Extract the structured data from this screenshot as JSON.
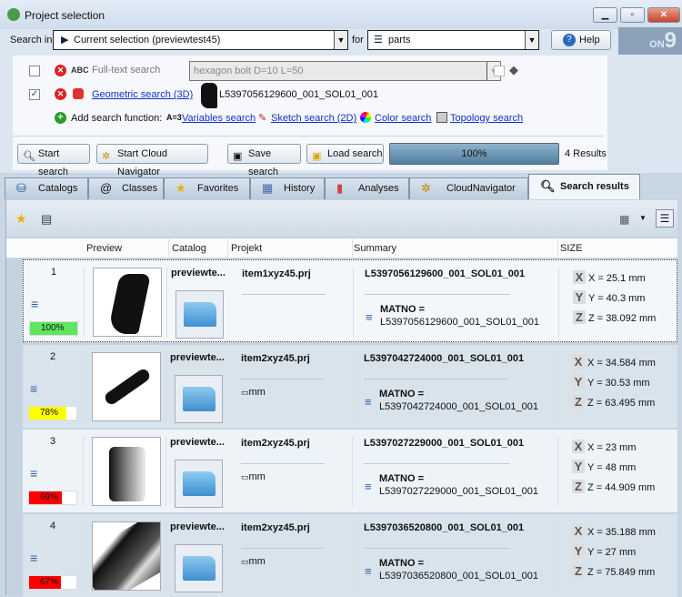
{
  "window": {
    "title": "Project selection"
  },
  "search": {
    "search_in_label": "Search in",
    "search_in_value": "Current selection (previewtest45)",
    "for_label": "for",
    "for_value": "parts",
    "help_label": "Help",
    "logo": "ON 9"
  },
  "fulltext": {
    "label": "Full-text search",
    "abc": "ABC",
    "value": "hexagon bolt D=10 L=50",
    "checked": false
  },
  "geometric": {
    "label": "Geometric search (3D)",
    "part": "L5397056129600_001_SOL01_001",
    "checked": true
  },
  "add_functions": {
    "label": "Add search function:",
    "var_icon": "A=3",
    "items": [
      "Variables search",
      "Sketch search (2D)",
      "Color search",
      "Topology search"
    ]
  },
  "actions": {
    "start_search": "Start search",
    "cloud_navigator": "Start Cloud Navigator",
    "save_search": "Save search",
    "load_search": "Load search",
    "progress": "100%",
    "progress_value": 100,
    "results": "4 Results"
  },
  "tabs": [
    "Catalogs",
    "Classes",
    "Favorites",
    "History",
    "Analyses",
    "CloudNavigator",
    "Search results"
  ],
  "columns": [
    "Preview",
    "Catalog",
    "Projekt",
    "Summary",
    "SIZE"
  ],
  "rows": [
    {
      "index": "1",
      "score": "100%",
      "score_value": 100,
      "score_color": "#5ee65e",
      "catalog": "previewte...",
      "project": "item1xyz45.prj",
      "unit": "",
      "summary": "L5397056129600_001_SOL01_001",
      "matno_label": "MATNO =",
      "matno": "L5397056129600_001_SOL01_001",
      "x": "X = 25.1 mm",
      "y": "Y = 40.3 mm",
      "z": "Z = 38.092 mm"
    },
    {
      "index": "2",
      "score": "78%",
      "score_value": 78,
      "score_color": "#ffff00",
      "catalog": "previewte...",
      "project": "item2xyz45.prj",
      "unit": "mm",
      "summary": "L5397042724000_001_SOL01_001",
      "matno_label": "MATNO =",
      "matno": "L5397042724000_001_SOL01_001",
      "x": "X = 34.584 mm",
      "y": "Y = 30.53 mm",
      "z": "Z = 63.495 mm"
    },
    {
      "index": "3",
      "score": "69%",
      "score_value": 69,
      "score_color": "#ff0000",
      "catalog": "previewte...",
      "project": "item2xyz45.prj",
      "unit": "mm",
      "summary": "L5397027229000_001_SOL01_001",
      "matno_label": "MATNO =",
      "matno": "L5397027229000_001_SOL01_001",
      "x": "X = 23 mm",
      "y": "Y = 48 mm",
      "z": "Z = 44.909 mm"
    },
    {
      "index": "4",
      "score": "67%",
      "score_value": 67,
      "score_color": "#ff0000",
      "catalog": "previewte...",
      "project": "item2xyz45.prj",
      "unit": "mm",
      "summary": "L5397036520800_001_SOL01_001",
      "matno_label": "MATNO =",
      "matno": "L5397036520800_001_SOL01_001",
      "x": "X = 35.188 mm",
      "y": "Y = 27 mm",
      "z": "Z = 75.849 mm"
    }
  ]
}
